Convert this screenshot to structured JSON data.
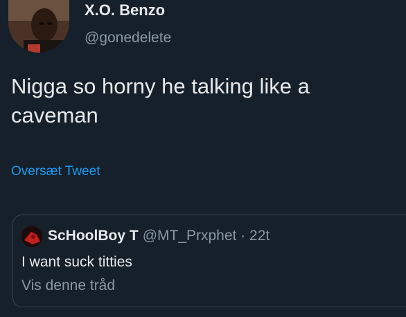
{
  "tweet": {
    "author_name": "X.O. Benzo",
    "author_handle": "@gonedelete",
    "text": "Nigga so horny he talking like a caveman",
    "translate_label": "Oversæt Tweet"
  },
  "quoted_tweet": {
    "author_name": "ScHoolBoy T",
    "meta": "@MT_Prxphet · 22t",
    "text": "I want suck titties",
    "thread_label": "Vis denne tråd"
  },
  "colors": {
    "background": "#15202b",
    "primary_text": "#e7e9ea",
    "secondary_text": "#8b98a5",
    "link": "#1d9bf0",
    "border": "#38444d"
  }
}
